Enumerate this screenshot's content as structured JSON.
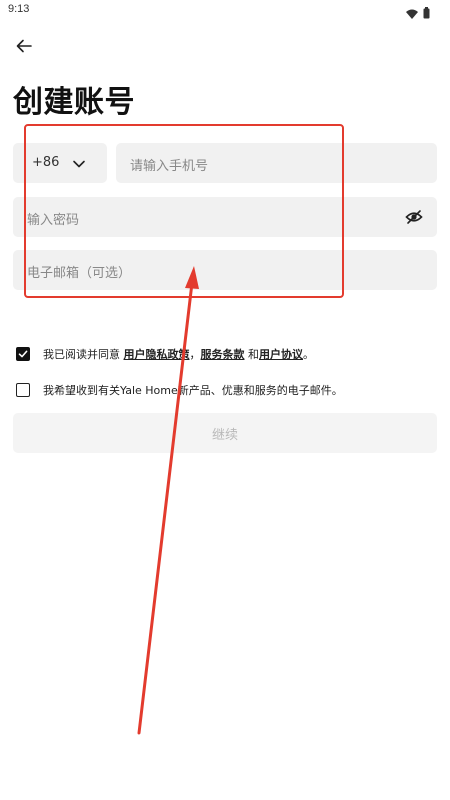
{
  "status_bar": {
    "time": "9:13",
    "icons": [
      "wifi-icon",
      "battery-icon"
    ]
  },
  "header": {
    "back_icon": "arrow-left-icon",
    "title": "创建账号"
  },
  "form": {
    "country_code": "+86",
    "phone_placeholder": "请输入手机号",
    "password_placeholder": "输入密码",
    "password_toggle_icon": "eye-off-icon",
    "email_placeholder": "电子邮箱（可选）"
  },
  "agreements": {
    "terms": {
      "checked": true,
      "prefix": "我已阅读并同意 ",
      "privacy_link": "用户隐私政策",
      "sep1": "，",
      "service_link": "服务条款",
      "sep2": " 和",
      "user_link": "用户协议",
      "suffix": "。"
    },
    "marketing": {
      "checked": false,
      "text": "我希望收到有关Yale Home新产品、优惠和服务的电子邮件。"
    }
  },
  "actions": {
    "continue_label": "继续"
  },
  "colors": {
    "annotation": "#e33b2e",
    "field_background": "#f1f1f1",
    "disabled_text": "#b9b9b9"
  }
}
